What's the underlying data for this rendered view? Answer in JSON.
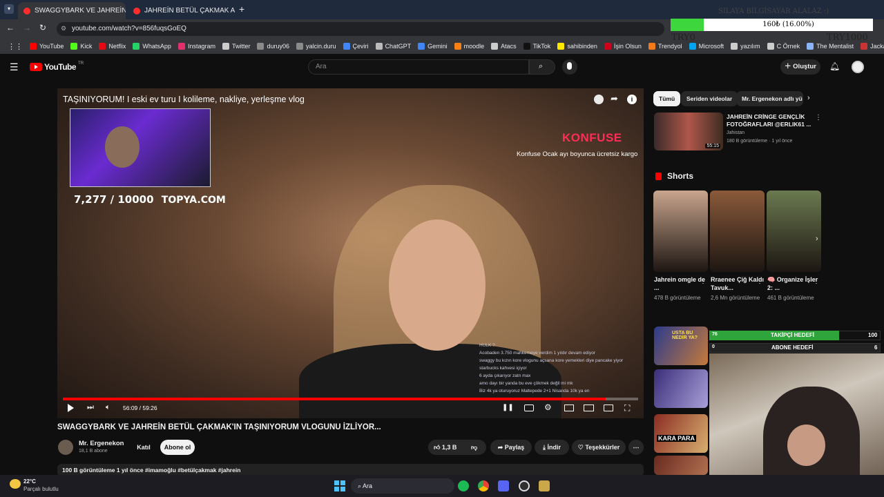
{
  "browser": {
    "tabs": [
      {
        "label": "SWAGGYBARK VE JAHREİN BETÜ"
      },
      {
        "label": "JAHREİN BETÜL ÇAKMAK ALIŞV"
      }
    ],
    "url": "youtube.com/watch?v=856fuqsGoEQ",
    "bookmarks": [
      {
        "label": "YouTube",
        "color": "#ff0000"
      },
      {
        "label": "Kick",
        "color": "#53fc18"
      },
      {
        "label": "Netflix",
        "color": "#e50914"
      },
      {
        "label": "WhatsApp",
        "color": "#25d366"
      },
      {
        "label": "Instagram",
        "color": "#e1306c"
      },
      {
        "label": "Twitter",
        "color": "#cccccc"
      },
      {
        "label": "duruy06",
        "color": "#8a8a8a"
      },
      {
        "label": "yalcin.duru",
        "color": "#8a8a8a"
      },
      {
        "label": "Çeviri",
        "color": "#4285f4"
      },
      {
        "label": "ChatGPT",
        "color": "#bbbbbb"
      },
      {
        "label": "Gemini",
        "color": "#4285f4"
      },
      {
        "label": "moodle",
        "color": "#f98012"
      },
      {
        "label": "Atacs",
        "color": "#cccccc"
      },
      {
        "label": "TikTok",
        "color": "#111111"
      },
      {
        "label": "sahibinden",
        "color": "#ffe800"
      },
      {
        "label": "İşin Olsun",
        "color": "#d0021b"
      },
      {
        "label": "Trendyol",
        "color": "#f27a1a"
      },
      {
        "label": "Microsoft",
        "color": "#00a4ef"
      },
      {
        "label": "yazılım",
        "color": "#cccccc"
      },
      {
        "label": "C Örnek",
        "color": "#cccccc"
      },
      {
        "label": "The Mentalist",
        "color": "#8ab4f8"
      },
      {
        "label": "Jackal",
        "color": "#cc3333"
      }
    ]
  },
  "budget_overlay": {
    "caption": "SILAYA BİLGİSAYAR ALALAZ :)",
    "amount": "160₺ (16.00%)",
    "min": "TRY0",
    "max": "TRY1000"
  },
  "header": {
    "logo": "YouTube",
    "country": "TR",
    "search_placeholder": "Ara",
    "create_label": "Oluştur"
  },
  "player": {
    "overlay_title": "TAŞINIYORUM! I eski ev turu I kolileme, nakliye, yerleşme vlog",
    "counter": "7,277  / 10000",
    "sponsor_site": "TOPYA.COM",
    "brand": "KONFUSE",
    "promo": "Konfuse Ocak ayı boyunca ücretsiz kargo",
    "time": "56:09 / 59:26",
    "progress_fraction": 0.944,
    "chat": [
      "HULK ?",
      "Acobaden 3.750 mahkemeye verdim 1 yıldır devam ediyor",
      "swaggy bu kızın kore vlogunu açsana kore yemekleri diye pancake yiyor starbucks kahvesi içiyor",
      "6 ayda çıkarıyor zatn max",
      "amo dayı bir yanda bu eve çökmek değil mi mk",
      "Biz 4k ya oturuyoruz Maltepede 2+1 Nisanda 10k ya en"
    ]
  },
  "video": {
    "title": "SWAGGYBARK VE JAHREİN BETÜL ÇAKMAK'IN TAŞINIYORUM VLOGUNU İZLİYOR...",
    "channel": "Mr. Ergenekon",
    "subscribers": "18,1 B abone",
    "join_label": "Katıl",
    "subscribe_label": "Abone ol",
    "likes": "1,3 B",
    "share_label": "Paylaş",
    "download_label": "İndir",
    "thanks_label": "Teşekkürler",
    "description_head": "100 B görüntüleme  1 yıl önce  #imamoğlu #betülçakmak #jahrein"
  },
  "sidebar": {
    "chips": [
      "Tümü",
      "Seriden videolar",
      "Mr. Ergenekon adlı yü"
    ],
    "rec": {
      "title": "JAHREİN CRİNGE GENÇLİK FOTOĞRAFLARI @ERLIK61 ...",
      "channel": "Jahistan",
      "meta": "180 B görüntüleme · 1 yıl önce",
      "duration": "55:15"
    },
    "shorts_heading": "Shorts",
    "shorts": [
      {
        "title": "Jahrein omgle de ...",
        "views": "478 B görüntüleme",
        "color": "#c9a58d"
      },
      {
        "title": "Rraenee Çiğ Kaldı Tavuk...",
        "views": "2,6 Mn görüntüleme",
        "color": "#8a5a3a"
      },
      {
        "title": "🧠 Organize İşler 2: ...",
        "views": "461 B görüntüleme",
        "color": "#6b7a50"
      }
    ]
  },
  "stream_overlay": {
    "follow_current": "76",
    "follow_label": "TAKİPÇİ HEDEFİ",
    "follow_target": "100",
    "follow_fraction": 0.76,
    "sub_current": "0",
    "sub_label": "ABONE HEDEFİ",
    "sub_target": "6",
    "thumb_text_1": "USTA BU NEDİR YA?",
    "thumb_text_2": "KARA PARA"
  },
  "taskbar": {
    "temperature": "22°C",
    "weather": "Parçalı bulutlu",
    "search_label": "Ara"
  }
}
